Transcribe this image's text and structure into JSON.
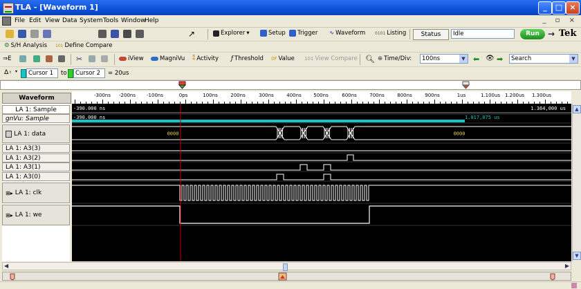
{
  "window": {
    "title": "TLA - [Waveform 1]"
  },
  "menu": [
    "File",
    "Edit",
    "View",
    "Data",
    "System",
    "Tools",
    "Window",
    "Help"
  ],
  "toolbar1": {
    "explorer": "Explorer",
    "setup": "Setup",
    "trigger": "Trigger",
    "waveform": "Waveform",
    "listing": "Listing",
    "status_label": "Status",
    "status_value": "Idle",
    "run": "Run",
    "brand": "Tek"
  },
  "toolbar2": {
    "sh_analysis": "S/H Analysis",
    "define_compare": "Define Compare"
  },
  "toolbar3": {
    "iview": "iView",
    "magnivu": "MagniVu",
    "activity": "Activity",
    "threshold": "Threshold",
    "value": "Value",
    "view_compare": "View Compare",
    "time_div_label": "Time/Div:",
    "time_div_value": "100ns",
    "search": "Search"
  },
  "cursorbar": {
    "cursor1": "Cursor 1",
    "to": "to",
    "cursor2": "Cursor 2",
    "delta": "= 20us"
  },
  "header": {
    "waveform": "Waveform"
  },
  "time_ticks": [
    "-300ns",
    "-200ns",
    "-100ns",
    "0ps",
    "100ns",
    "200ns",
    "300ns",
    "400ns",
    "500ns",
    "600ns",
    "700ns",
    "800ns",
    "900ns",
    "1us",
    "1.100us",
    "1.200us",
    "1.300us"
  ],
  "channels": [
    {
      "label": "LA 1: Sample",
      "kind": "sample"
    },
    {
      "label": "MagniVu: Sample",
      "label_display": "gnVu: Sample",
      "kind": "magnivu"
    },
    {
      "label": "LA 1: data",
      "kind": "bus"
    },
    {
      "label": "LA 1: A3(3)",
      "kind": "bit"
    },
    {
      "label": "LA 1: A3(2)",
      "kind": "bit"
    },
    {
      "label": "LA 1: A3(1)",
      "kind": "bit"
    },
    {
      "label": "LA 1: A3(0)",
      "kind": "bit"
    },
    {
      "label": "LA 1: clk",
      "kind": "group"
    },
    {
      "label": "LA 1: we",
      "kind": "group"
    }
  ],
  "readouts": {
    "sample_start": "-390.000 ns",
    "sample_end": "1.364,000 us",
    "magnivu_start": "-390.000 ns",
    "magnivu_end": "1.017,875 us",
    "bus_value_left": "0000",
    "bus_value_right": "0000"
  },
  "colors": {
    "trace": "#ffffff",
    "magnivu": "#19c4c4",
    "cursor": "#c00000",
    "background": "#000000"
  }
}
